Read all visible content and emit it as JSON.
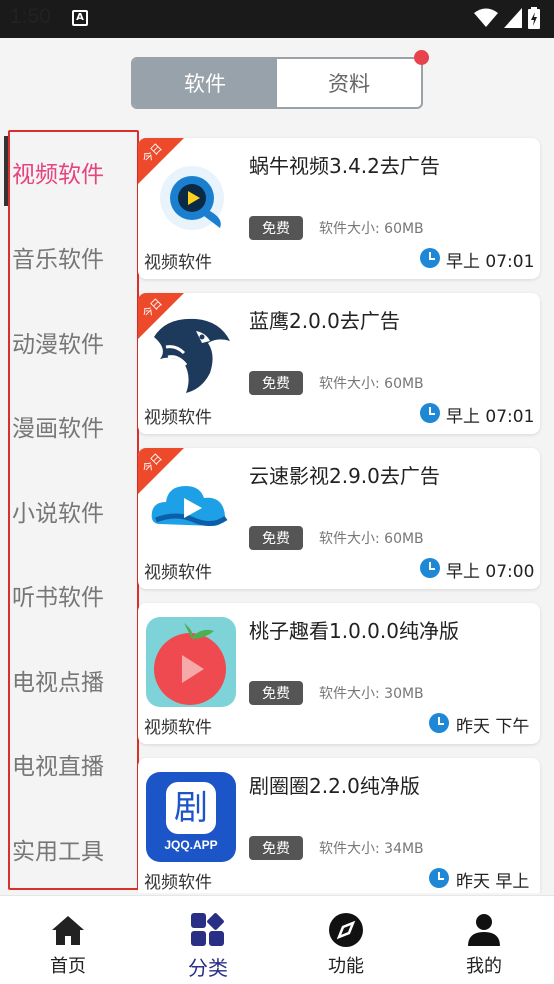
{
  "status": {
    "time": "1:50",
    "notif": "A"
  },
  "segment": {
    "tabs": [
      {
        "label": "软件"
      },
      {
        "label": "资料"
      }
    ]
  },
  "sidebar": {
    "items": [
      {
        "label": "视频软件"
      },
      {
        "label": "音乐软件"
      },
      {
        "label": "动漫软件"
      },
      {
        "label": "漫画软件"
      },
      {
        "label": "小说软件"
      },
      {
        "label": "听书软件"
      },
      {
        "label": "电视点播"
      },
      {
        "label": "电视直播"
      },
      {
        "label": "实用工具"
      }
    ]
  },
  "list": {
    "items": [
      {
        "title": "蜗牛视频3.4.2去广告",
        "badge": "今日",
        "free": "免费",
        "size": "软件大小: 60MB",
        "category": "视频软件",
        "time": "早上 07:01",
        "icon": "snail-video-icon"
      },
      {
        "title": "蓝鹰2.0.0去广告",
        "badge": "今日",
        "free": "免费",
        "size": "软件大小: 60MB",
        "category": "视频软件",
        "time": "早上 07:01",
        "icon": "eagle-icon"
      },
      {
        "title": "云速影视2.9.0去广告",
        "badge": "今日",
        "free": "免费",
        "size": "软件大小: 60MB",
        "category": "视频软件",
        "time": "早上 07:00",
        "icon": "cloud-play-icon"
      },
      {
        "title": "桃子趣看1.0.0.0纯净版",
        "free": "免费",
        "size": "软件大小: 30MB",
        "category": "视频软件",
        "time": "昨天 下午",
        "icon": "peach-play-icon"
      },
      {
        "title": "剧圈圈2.2.0纯净版",
        "free": "免费",
        "size": "软件大小: 34MB",
        "category": "视频软件",
        "time": "昨天 早上",
        "icon": "jqq-icon",
        "icon_text": "剧",
        "icon_caption": "JQQ.APP"
      }
    ]
  },
  "nav": {
    "items": [
      {
        "label": "首页"
      },
      {
        "label": "分类"
      },
      {
        "label": "功能"
      },
      {
        "label": "我的"
      }
    ]
  },
  "colors": {
    "accent": "#e7437f",
    "nav_active": "#2a2f86",
    "outline": "#d9302c",
    "clock": "#1e88d6",
    "ribbon": "#ec4a2a"
  }
}
